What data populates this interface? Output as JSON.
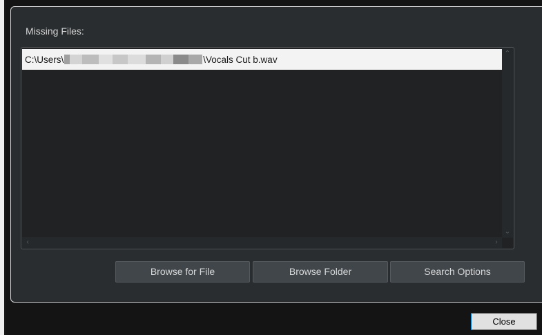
{
  "dialog": {
    "missing_files_label": "Missing Files:",
    "files": [
      {
        "path_prefix": "C:\\Users\\",
        "path_suffix": "\\Vocals Cut b.wav"
      }
    ]
  },
  "buttons": {
    "browse_file": "Browse for File",
    "browse_folder": "Browse Folder",
    "search_options": "Search Options",
    "close": "Close"
  },
  "icons": {
    "scroll_up": "chevron-up-icon",
    "scroll_down": "chevron-down-icon",
    "scroll_left": "chevron-left-icon",
    "scroll_right": "chevron-right-icon"
  },
  "colors": {
    "panel_background": "#2a2d2f",
    "list_background": "#202224",
    "selected_row": "#f3f3f3",
    "button_background": "#41464a",
    "close_button_border": "#0078d7"
  }
}
